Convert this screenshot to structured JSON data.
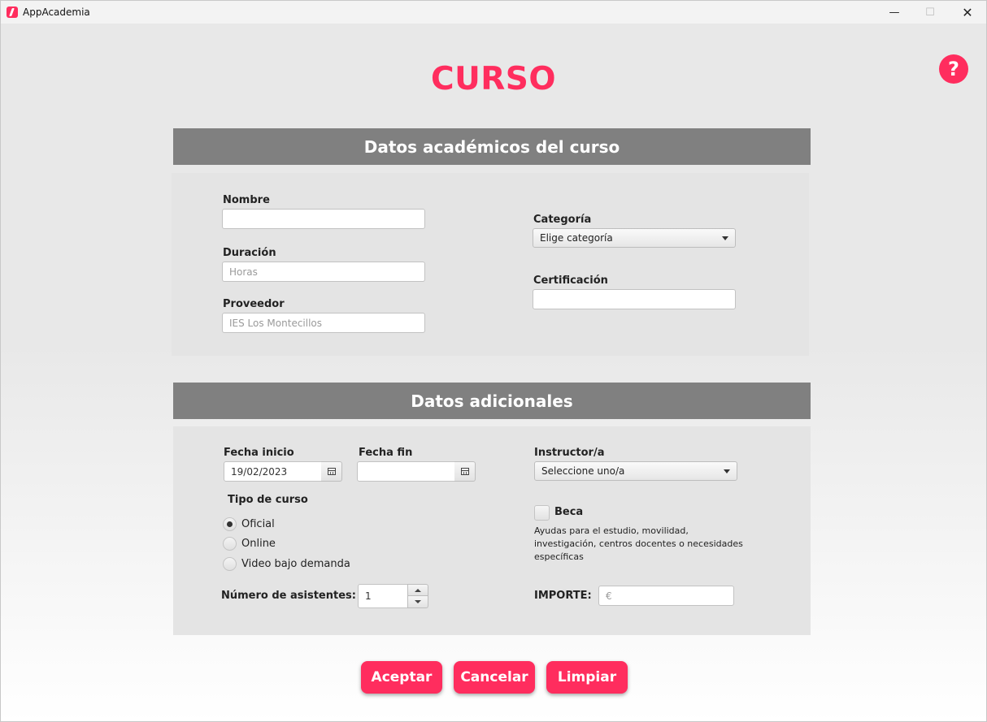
{
  "window": {
    "title": "AppAcademia",
    "minimize": "—",
    "maximize": "☐",
    "close": "✕"
  },
  "page": {
    "title": "CURSO",
    "help_label": "?"
  },
  "academic": {
    "header": "Datos académicos del curso",
    "nombre_label": "Nombre",
    "nombre_value": "",
    "duracion_label": "Duración",
    "duracion_placeholder": "Horas",
    "proveedor_label": "Proveedor",
    "proveedor_placeholder": "IES Los Montecillos",
    "categoria_label": "Categoría",
    "categoria_value": "Elige categoría",
    "certificacion_label": "Certificación",
    "certificacion_value": ""
  },
  "additional": {
    "header": "Datos adicionales",
    "fecha_inicio_label": "Fecha inicio",
    "fecha_inicio_value": "19/02/2023",
    "fecha_fin_label": "Fecha fin",
    "fecha_fin_value": "",
    "instructor_label": "Instructor/a",
    "instructor_value": "Seleccione uno/a",
    "tipo_label": "Tipo de curso",
    "tipo_options": [
      {
        "label": "Oficial",
        "checked": true
      },
      {
        "label": "Online",
        "checked": false
      },
      {
        "label": "Video bajo demanda",
        "checked": false
      }
    ],
    "beca_label": "Beca",
    "beca_checked": false,
    "beca_help": "Ayudas para el estudio, movilidad, investigación, centros docentes o necesidades específicas",
    "asistentes_label": "Número de asistentes:",
    "asistentes_value": "1",
    "importe_label": "IMPORTE:",
    "importe_placeholder": "€"
  },
  "actions": {
    "accept": "Aceptar",
    "cancel": "Cancelar",
    "clear": "Limpiar"
  },
  "colors": {
    "accent": "#ff2d5e",
    "section_header": "#808080",
    "panel": "#e4e4e4"
  }
}
